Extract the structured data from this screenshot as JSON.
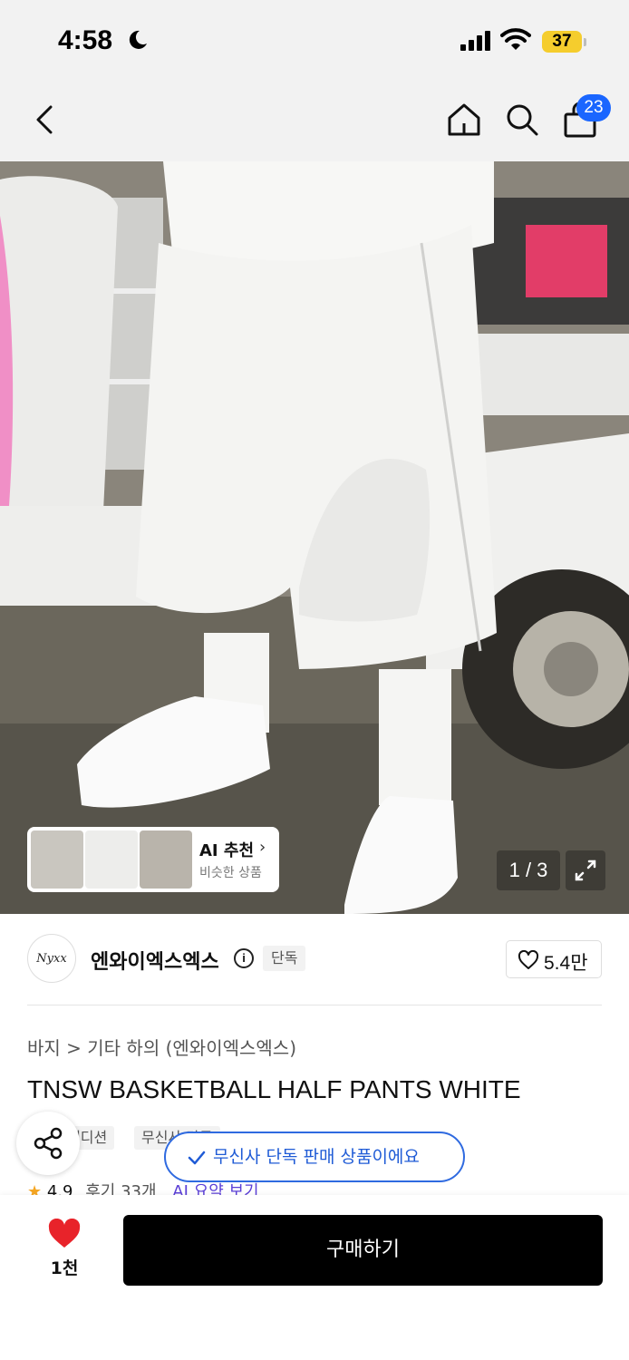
{
  "status_bar": {
    "time": "4:58",
    "battery": "37"
  },
  "nav": {
    "cart_count": "23"
  },
  "gallery": {
    "counter": "1 / 3",
    "ai_card": {
      "title": "AI 추천",
      "subtitle": "비슷한 상품"
    }
  },
  "brand": {
    "logo_text": "Nyxx",
    "name": "엔와이엑스엑스",
    "tag": "단독",
    "like_count": "5.4만"
  },
  "product": {
    "breadcrumb": "바지  >  기타 하의 (엔와이엑스엑스)",
    "title": "TNSW BASKETBALL HALF PANTS WHITE",
    "tags": [
      "에디션",
      "무신사 단독"
    ],
    "rating": "4.9",
    "reviews": "후기 33개",
    "ai_summary": "AI 요약 보기"
  },
  "toast": "무신사 단독 판매 상품이에요",
  "bottom": {
    "wish_count": "1천",
    "buy_label": "구매하기"
  },
  "colors": {
    "accent": "#1a66ff",
    "toast": "#2f6ae0",
    "buy": "#000000",
    "heart": "#e8232a"
  }
}
